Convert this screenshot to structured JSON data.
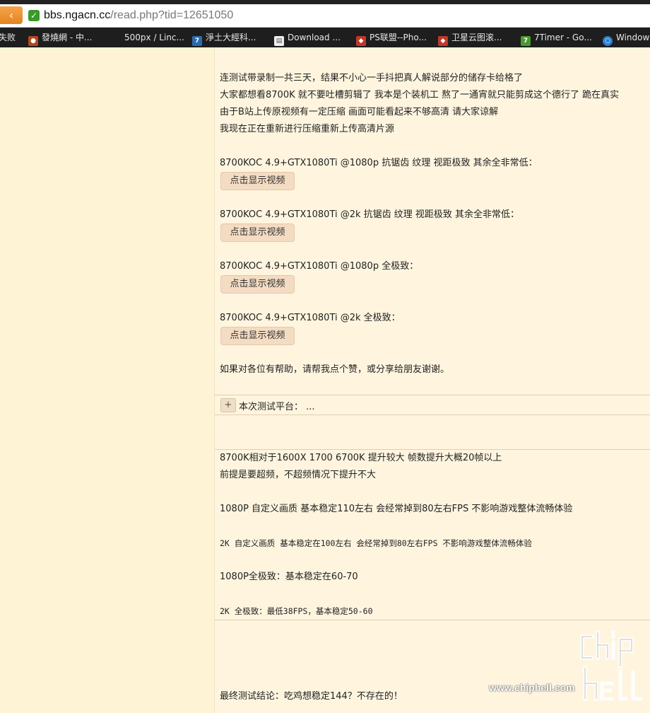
{
  "browser": {
    "back_icon": "back-arrow-icon",
    "secure_icon": "secure-check-icon",
    "url_host": "bbs.ngacn.cc",
    "url_path": "/read.php?tid=12651050",
    "bookmarks": [
      {
        "label": "失败",
        "icon": "none"
      },
      {
        "label": "發燒網 - 中...",
        "icon": "site-icon"
      },
      {
        "label": "500px / Linc...",
        "icon": "none"
      },
      {
        "label": "淨土大經科...",
        "icon": "seven-icon"
      },
      {
        "label": "Download ...",
        "icon": "page-icon"
      },
      {
        "label": "PS联盟--Pho...",
        "icon": "ps-icon"
      },
      {
        "label": "卫星云图滚...",
        "icon": "ps-icon"
      },
      {
        "label": "7Timer - Go...",
        "icon": "timer-icon"
      },
      {
        "label": "Window",
        "icon": "globe-icon"
      }
    ]
  },
  "post": {
    "intro": [
      "连测试带录制一共三天，结果不小心一手抖把真人解说部分的储存卡给格了",
      "大家都想看8700K 就不要吐槽剪辑了 我本是个装机工 熬了一通宵就只能剪成这个德行了 跪在真实",
      "由于B站上传原视频有一定压缩 画面可能看起来不够高清 请大家谅解",
      "我现在正在重新进行压缩重新上传高清片源"
    ],
    "videos": [
      {
        "label": "8700KOC 4.9+GTX1080Ti @1080p 抗锯齿 纹理 视距极致 其余全非常低：",
        "button": "点击显示视频"
      },
      {
        "label": "8700KOC 4.9+GTX1080Ti @2k 抗锯齿 纹理 视距极致 其余全非常低：",
        "button": "点击显示视频"
      },
      {
        "label": "8700KOC 4.9+GTX1080Ti @1080p 全极致：",
        "button": "点击显示视频"
      },
      {
        "label": "8700KOC 4.9+GTX1080Ti @2k 全极致：",
        "button": "点击显示视频"
      }
    ],
    "help_text": "如果对各位有帮助，请帮我点个赞，或分享给朋友谢谢。",
    "collapse": {
      "toggle": "+",
      "label": "本次测试平台： ..."
    },
    "results": [
      "8700K相对于1600X 1700 6700K 提升较大 帧数提升大概20帧以上",
      "前提是要超频，不超频情况下提升不大",
      "1080P 自定义画质 基本稳定110左右 会经常掉到80左右FPS 不影响游戏整体流畅体验",
      "2K 自定义画质 基本稳定在100左右 会经常掉到80左右FPS 不影响游戏整体流畅体验",
      "1080P全极致：基本稳定在60-70",
      "2K 全极致：最低38FPS，基本稳定50-60"
    ],
    "conclusion": "最终测试结论：吃鸡想稳定144？不存在的！"
  },
  "watermark": {
    "site": "www.chiphell.com",
    "logo": "chiphell-logo"
  }
}
